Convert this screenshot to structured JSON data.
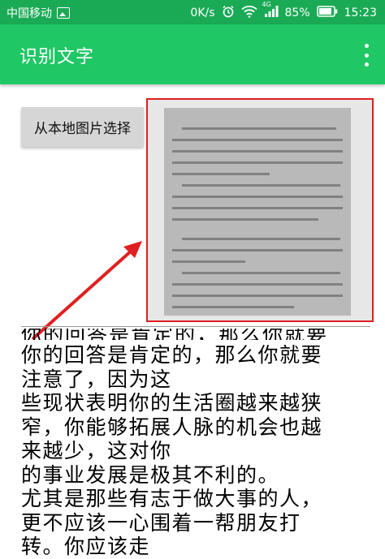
{
  "status_bar": {
    "carrier": "中国移动",
    "network_speed": "0K/s",
    "network_type": "4G",
    "battery": "85%",
    "time": "15:23"
  },
  "app_bar": {
    "title": "识别文字"
  },
  "pick_button": {
    "label": "从本地图片选择"
  },
  "recognized_text": {
    "partial_top_line": "你的回答是肯定的，那么你就要",
    "lines": [
      "你的回答是肯定的，那么你就要",
      "注意了，因为这",
      "些现状表明你的生活圈越来越狭",
      "窄，你能够拓展人脉的机会也越",
      "来越少，这对你",
      "的事业发展是极其不利的。",
      "尤其是那些有志于做大事的人，",
      "更不应该一心围着一帮朋友打",
      "转。你应该走"
    ]
  },
  "colors": {
    "status_bar_bg": "#1aaa55",
    "app_bar_bg": "#1fc765",
    "annotation_red": "#e02020"
  }
}
